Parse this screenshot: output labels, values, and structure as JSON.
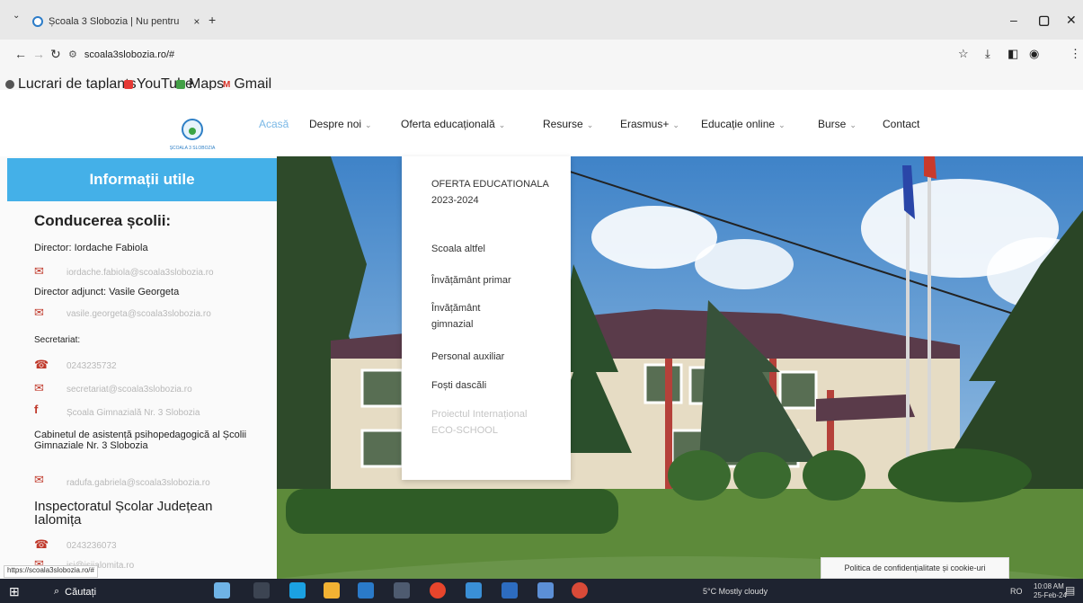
{
  "browser": {
    "tab_title": "Școala 3 Slobozia | Nu pentru",
    "tab_close": "×",
    "new_tab": "+",
    "url": "scoala3slobozia.ro/#",
    "bookmarks": [
      "Lucrari de taplants",
      "YouTube",
      "Maps",
      "Gmail"
    ],
    "status_url": "https://scoala3slobozia.ro/#"
  },
  "site": {
    "logo_text": "ȘCOALA 3 SLOBOZIA",
    "menu": [
      {
        "label": "Acasă",
        "active": true,
        "caret": false
      },
      {
        "label": "Despre noi",
        "caret": true
      },
      {
        "label": "Oferta educațională",
        "caret": true
      },
      {
        "label": "Resurse",
        "caret": true
      },
      {
        "label": "Erasmus+",
        "caret": true
      },
      {
        "label": "Educație online",
        "caret": true
      },
      {
        "label": "Burse",
        "caret": true
      },
      {
        "label": "Contact",
        "caret": false
      }
    ]
  },
  "sidebar": {
    "banner": "Informații utile",
    "heading1": "Conducerea școlii:",
    "director": "Director: Iordache Fabiola",
    "director_email": "iordache.fabiola@scoala3slobozia.ro",
    "deputy": "Director adjunct: Vasile Georgeta",
    "deputy_email": "vasile.georgeta@scoala3slobozia.ro",
    "secretariat_label": "Secretariat:",
    "secretariat_phone": "0243235732",
    "secretariat_email": "secretariat@scoala3slobozia.ro",
    "facebook": "Școala Gimnazială Nr. 3 Slobozia",
    "cabinet": "Cabinetul de asistență psihopedagogică al Școlii Gimnaziale Nr. 3 Slobozia",
    "cabinet_email": "radufa.gabriela@scoala3slobozia.ro",
    "heading2": "Inspectoratul Școlar Județean Ialomița",
    "isj_phone": "0243236073",
    "isj_email": "isj@isjialomita.ro"
  },
  "dropdown": {
    "items": [
      {
        "label": "OFERTA EDUCATIONALA 2023-2024",
        "muted": false
      },
      {
        "label": "Scoala altfel",
        "muted": false
      },
      {
        "label": "Învățământ primar",
        "muted": false
      },
      {
        "label": "Învățământ gimnazial",
        "muted": false
      },
      {
        "label": "Personal auxiliar",
        "muted": false
      },
      {
        "label": "Foști dascăli",
        "muted": false
      },
      {
        "label": "Proiectul Internațional ECO-SCHOOL",
        "muted": true
      }
    ]
  },
  "cookie_notice": "Politica de confidențialitate și cookie-uri",
  "taskbar": {
    "search_label": "Căutați",
    "weather": "5°C  Mostly cloudy",
    "language": "RO",
    "time": "10:08 AM",
    "date": "25-Feb-24"
  },
  "colors": {
    "banner": "#44b0e8",
    "menu_active": "#7ab8e6",
    "icon_red": "#c0392b"
  }
}
